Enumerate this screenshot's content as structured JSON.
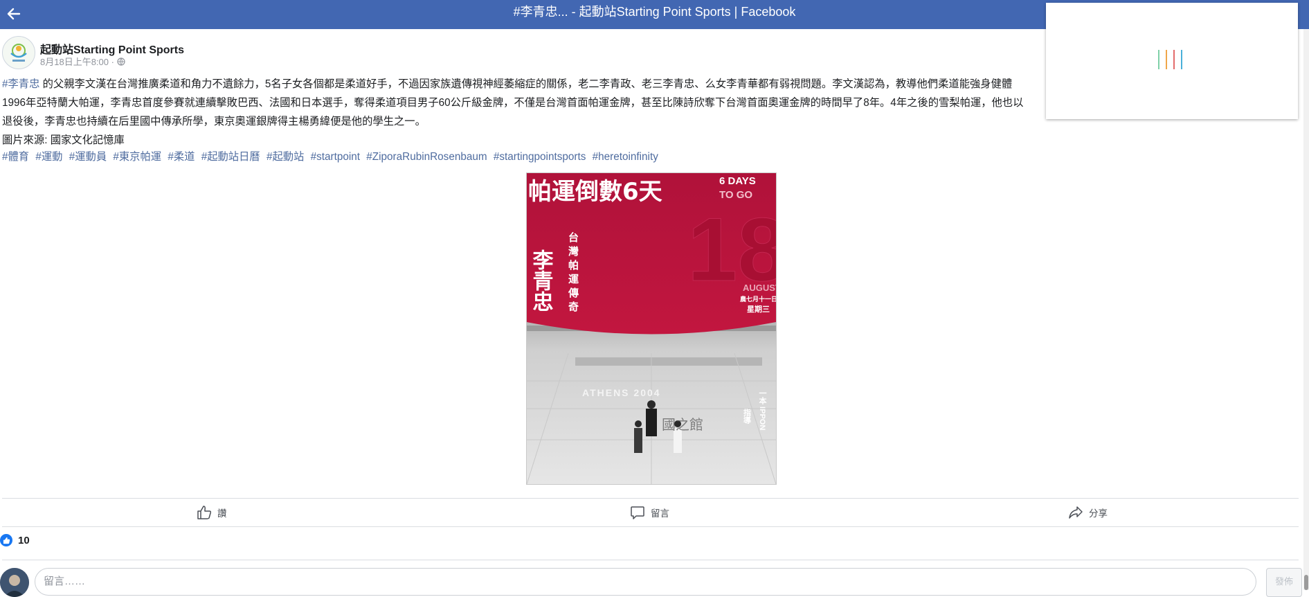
{
  "window": {
    "title": "#李青忠... - 起動站Starting Point Sports | Facebook"
  },
  "colors": {
    "topbar": "#4267b2",
    "hashtag": "#4f6c9f",
    "like_blue": "#1877f2",
    "poster_red": "#b0123a"
  },
  "icons": {
    "back": "left-arrow-icon",
    "privacy": "globe-icon",
    "like": "thumbs-up-icon",
    "comment": "speech-bubble-icon",
    "share": "share-arrow-icon"
  },
  "post": {
    "page_name": "起動站Starting Point Sports",
    "meta": "8月18日上午8:00 ·",
    "text": {
      "mention": "#李青忠",
      "line1": " 的父親李文漢在台灣推廣柔道和角力不遺餘力，5名子女各個都是柔道好手，不過因家族遺傳視神經萎縮症的關係，老二李青政、老三李青忠、么女李青華都有弱視問題。李文漢認為，教導他們柔道能強身健體",
      "line2": "1996年亞特蘭大帕運，李青忠首度參賽就連續擊敗巴西、法國和日本選手，奪得柔道項目男子60公斤級金牌，不僅是台灣首面帕運金牌，甚至比陳詩欣奪下台灣首面奧運金牌的時間早了8年。4年之後的雪梨帕運，他也以",
      "line3": "退役後，李青忠也持續在后里國中傳承所學，東京奧運銀牌得主楊勇緯便是他的學生之一。",
      "line4": "圖片來源: 國家文化記憶庫"
    },
    "hashtags": [
      "#體育",
      "#運動",
      "#運動員",
      "#東京帕運",
      "#柔道",
      "#起動站日曆",
      "#起動站",
      "#startpoint",
      "#ZiporaRubinRosenbaum",
      "#startingpointsports",
      "#heretoinfinity"
    ],
    "poster": {
      "headline": "帕運倒數6天",
      "days_en_1": "6 DAYS",
      "days_en_2": "TO GO",
      "big_number": "18",
      "month": "AUGUST",
      "lunar": "農七月十一日",
      "weekday": "星期三",
      "name": "李青忠",
      "subtitle_chars": [
        "台",
        "灣",
        "帕",
        "運",
        "傳",
        "奇"
      ],
      "banner_text": "ATHENS 2004",
      "side_text_1": "一本 IPPON",
      "side_text_2": "指導",
      "watermark": "國之館"
    },
    "actions": {
      "like": "讚",
      "comment": "留言",
      "share": "分享"
    },
    "like_count": "10",
    "comment_placeholder": "留言……",
    "post_button": "發佈"
  }
}
